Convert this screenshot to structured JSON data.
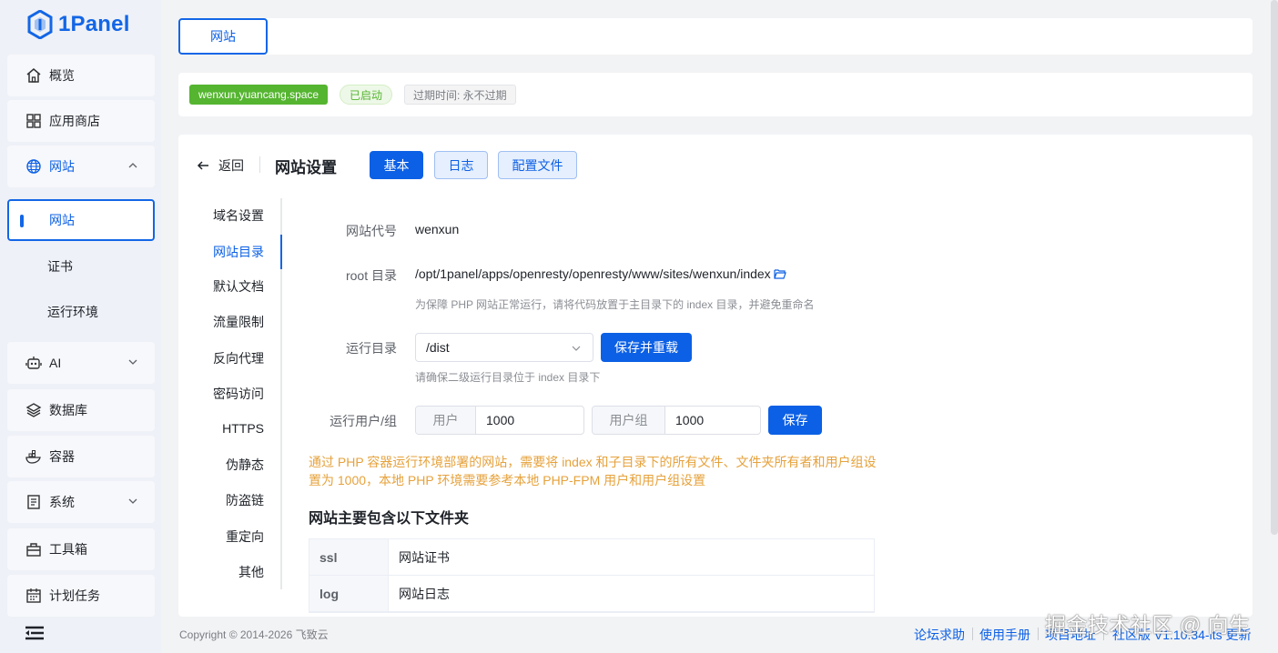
{
  "app": {
    "logo_text": "1Panel"
  },
  "sidebar": {
    "items": [
      {
        "label": "概览"
      },
      {
        "label": "应用商店"
      },
      {
        "label": "网站"
      },
      {
        "label": "AI"
      },
      {
        "label": "数据库"
      },
      {
        "label": "容器"
      },
      {
        "label": "系统"
      },
      {
        "label": "工具箱"
      },
      {
        "label": "计划任务"
      }
    ],
    "website_children": [
      {
        "label": "网站"
      },
      {
        "label": "证书"
      },
      {
        "label": "运行环境"
      }
    ]
  },
  "topbar": {
    "tab_label": "网站"
  },
  "site": {
    "domain": "wenxun.yuancang.space",
    "status": "已启动",
    "expire": "过期时间: 永不过期"
  },
  "main": {
    "back_label": "返回",
    "title": "网站设置",
    "tabs": [
      {
        "label": "基本"
      },
      {
        "label": "日志"
      },
      {
        "label": "配置文件"
      }
    ],
    "menu": [
      {
        "label": "域名设置"
      },
      {
        "label": "网站目录"
      },
      {
        "label": "默认文档"
      },
      {
        "label": "流量限制"
      },
      {
        "label": "反向代理"
      },
      {
        "label": "密码访问"
      },
      {
        "label": "HTTPS"
      },
      {
        "label": "伪静态"
      },
      {
        "label": "防盗链"
      },
      {
        "label": "重定向"
      },
      {
        "label": "其他"
      }
    ],
    "form": {
      "alias_label": "网站代号",
      "alias_value": "wenxun",
      "root_label": "root 目录",
      "root_value": "/opt/1panel/apps/openresty/openresty/www/sites/wenxun/index",
      "root_hint": "为保障 PHP 网站正常运行，请将代码放置于主目录下的 index 目录，并避免重命名",
      "run_dir_label": "运行目录",
      "run_dir_value": "/dist",
      "save_reload_label": "保存并重载",
      "run_dir_hint": "请确保二级运行目录位于 index 目录下",
      "run_user_label": "运行用户/组",
      "user_prefix": "用户",
      "user_value": "1000",
      "group_prefix": "用户组",
      "group_value": "1000",
      "save_label": "保存"
    },
    "warning": "通过 PHP 容器运行环境部署的网站，需要将 index 和子目录下的所有文件、文件夹所有者和用户组设置为 1000，本地 PHP 环境需要参考本地 PHP-FPM 用户和用户组设置",
    "folders_title": "网站主要包含以下文件夹",
    "folders": [
      {
        "name": "ssl",
        "desc": "网站证书"
      },
      {
        "name": "log",
        "desc": "网站日志"
      }
    ]
  },
  "footer": {
    "copyright": "Copyright © 2014-2026 飞致云",
    "links": [
      {
        "label": "论坛求助"
      },
      {
        "label": "使用手册"
      },
      {
        "label": "项目地址"
      },
      {
        "label": "社区版 V1.10.34-lts 更新"
      }
    ]
  },
  "watermark": "掘金技术社区 @ 向生",
  "colors": {
    "primary": "#0c60e5",
    "success": "#55b530",
    "warning": "#e6a23c"
  }
}
